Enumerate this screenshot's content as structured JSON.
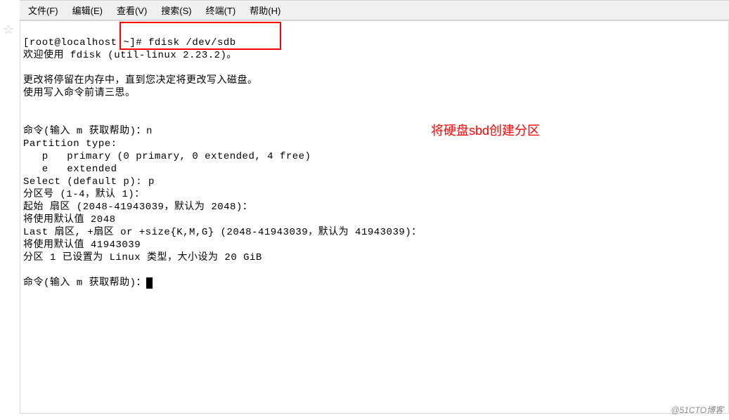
{
  "menubar": {
    "items": [
      {
        "label": "文件(F)"
      },
      {
        "label": "编辑(E)"
      },
      {
        "label": "查看(V)"
      },
      {
        "label": "搜索(S)"
      },
      {
        "label": "终端(T)"
      },
      {
        "label": "帮助(H)"
      }
    ]
  },
  "star_icon": "☆",
  "terminal": {
    "lines": [
      "[root@localhost ~]# fdisk /dev/sdb",
      "欢迎使用 fdisk (util-linux 2.23.2)。",
      "",
      "更改将停留在内存中，直到您决定将更改写入磁盘。",
      "使用写入命令前请三思。",
      "",
      "",
      "命令(输入 m 获取帮助)：n",
      "Partition type:",
      "   p   primary (0 primary, 0 extended, 4 free)",
      "   e   extended",
      "Select (default p): p",
      "分区号 (1-4，默认 1)：",
      "起始 扇区 (2048-41943039，默认为 2048)：",
      "将使用默认值 2048",
      "Last 扇区, +扇区 or +size{K,M,G} (2048-41943039，默认为 41943039)：",
      "将使用默认值 41943039",
      "分区 1 已设置为 Linux 类型，大小设为 20 GiB",
      "",
      "命令(输入 m 获取帮助)："
    ]
  },
  "annotation_text": "将硬盘sbd创建分区",
  "watermark": "@51CTO博客"
}
